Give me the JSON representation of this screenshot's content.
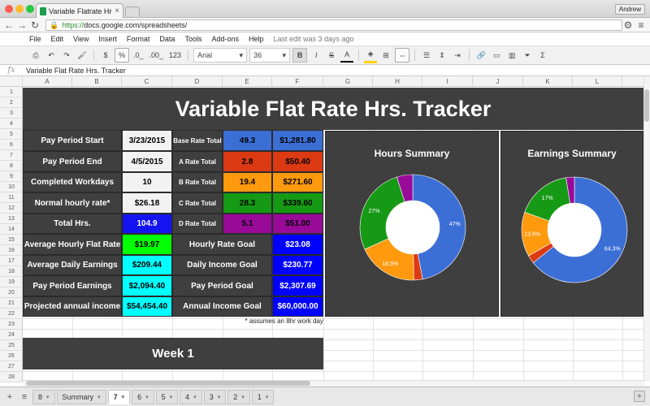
{
  "browser": {
    "tab_title": "Variable Flatrate Hrs. Track",
    "user": "Andrew",
    "url_scheme": "https://",
    "url_rest": "docs.google.com/spreadsheets/"
  },
  "menu": {
    "items": [
      "File",
      "Edit",
      "View",
      "Insert",
      "Format",
      "Data",
      "Tools",
      "Add-ons",
      "Help"
    ],
    "last_edit": "Last edit was 3 days ago"
  },
  "toolbar": {
    "currency": "$",
    "percent": "%",
    "dec_less": ".0_",
    "dec_more": ".00_",
    "more_formats": "123",
    "font": "Arial",
    "size": "36",
    "bold": "B",
    "italic": "I",
    "strike": "S",
    "text_color": "A"
  },
  "formula": {
    "fx": "fx",
    "value": "Variable Flat Rate Hrs. Tracker"
  },
  "columns": [
    "A",
    "B",
    "C",
    "D",
    "E",
    "F",
    "G",
    "H",
    "I",
    "J",
    "K",
    "L"
  ],
  "rows": [
    "1",
    "2",
    "3",
    "4",
    "5",
    "6",
    "7",
    "8",
    "9",
    "10",
    "11",
    "12",
    "13",
    "14",
    "15",
    "16",
    "17",
    "18",
    "19",
    "20",
    "21",
    "22",
    "23",
    "24",
    "25",
    "26",
    "27",
    "28"
  ],
  "sheet": {
    "title": "Variable Flat Rate Hrs. Tracker",
    "left_block": [
      {
        "label": "Pay Period Start",
        "value": "3/23/2015",
        "color": "#f2f2f2",
        "text": "#000"
      },
      {
        "label": "Pay Period End",
        "value": "4/5/2015",
        "color": "#f2f2f2",
        "text": "#000"
      },
      {
        "label": "Completed Workdays",
        "value": "10",
        "color": "#f2f2f2",
        "text": "#000"
      },
      {
        "label": "Normal hourly rate*",
        "value": "$26.18",
        "color": "#f2f2f2",
        "text": "#000"
      },
      {
        "label": "Total Hrs.",
        "value": "104.9",
        "color": "#1414f0",
        "text": "#fff"
      }
    ],
    "rate_block": [
      {
        "label": "Base Rate Total",
        "hrs": "49.3",
        "amt": "$1,281.80",
        "color": "#3c6fd6"
      },
      {
        "label": "A Rate Total",
        "hrs": "2.8",
        "amt": "$50.40",
        "color": "#dc3a13"
      },
      {
        "label": "B Rate Total",
        "hrs": "19.4",
        "amt": "$271.60",
        "color": "#ff9a0e"
      },
      {
        "label": "C Rate Total",
        "hrs": "28.3",
        "amt": "$339.60",
        "color": "#169a15"
      },
      {
        "label": "D Rate Total",
        "hrs": "5.1",
        "amt": "$51.00",
        "color": "#990a99"
      }
    ],
    "stats": [
      {
        "label": "Average Hourly Flat Rate",
        "value": "$19.97",
        "color": "#00ff00",
        "goal_label": "Hourly Rate Goal",
        "goal": "$23.08"
      },
      {
        "label": "Average Daily Earnings",
        "value": "$209.44",
        "color": "#00ffff",
        "goal_label": "Daily Income Goal",
        "goal": "$230.77"
      },
      {
        "label": "Pay Period Earnings",
        "value": "$2,094.40",
        "color": "#00ffff",
        "goal_label": "Pay Period Goal",
        "goal": "$2,307.69"
      },
      {
        "label": "Projected annual income",
        "value": "$54,454.40",
        "color": "#00ffff",
        "goal_label": "Annual Income Goal",
        "goal": "$60,000.00"
      }
    ],
    "goal_color": "#0000ff",
    "note": "* assumes an 8hr work day",
    "week_header": "Week 1"
  },
  "chart_data": [
    {
      "type": "pie",
      "title": "Hours Summary",
      "categories": [
        "Base Rate Total",
        "A Rate Total",
        "B Rate Total",
        "C Rate Total",
        "D Rate Total"
      ],
      "values": [
        49.3,
        2.8,
        19.4,
        28.3,
        5.1
      ],
      "labels": [
        "47%",
        "",
        "18.5%",
        "27%",
        ""
      ],
      "colors": [
        "#3c6fd6",
        "#dc3a13",
        "#ff9a0e",
        "#169a15",
        "#990a99"
      ]
    },
    {
      "type": "pie",
      "title": "Earnings Summary",
      "categories": [
        "Base Rate Total",
        "A Rate Total",
        "B Rate Total",
        "C Rate Total",
        "D Rate Total"
      ],
      "values": [
        1281.8,
        50.4,
        271.6,
        339.6,
        51.0
      ],
      "labels": [
        "64.3%",
        "",
        "13.6%",
        "17%",
        ""
      ],
      "colors": [
        "#3c6fd6",
        "#dc3a13",
        "#ff9a0e",
        "#169a15",
        "#990a99"
      ]
    }
  ],
  "sheet_tabs": {
    "add": "+",
    "list": "≡",
    "tabs": [
      "8",
      "Summary",
      "7",
      "6",
      "5",
      "4",
      "3",
      "2",
      "1"
    ],
    "active": "7",
    "explore": "+"
  }
}
